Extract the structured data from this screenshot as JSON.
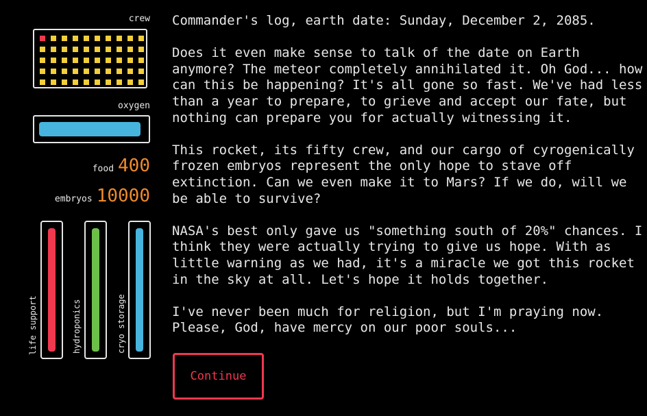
{
  "sidebar": {
    "crew": {
      "label": "crew",
      "total": 50,
      "active_index": 0,
      "dot_color": "#f2cf3a",
      "active_color": "#f0384f"
    },
    "oxygen": {
      "label": "oxygen",
      "level": 0.97,
      "color": "#47b4dd"
    },
    "food": {
      "label": "food",
      "value": "400"
    },
    "embryos": {
      "label": "embryos",
      "value": "10000"
    },
    "gauges": [
      {
        "label": "life support",
        "level": 1.0,
        "color": "#f0384f"
      },
      {
        "label": "hydroponics",
        "level": 1.0,
        "color": "#6cc04a"
      },
      {
        "label": "cryo storage",
        "level": 1.0,
        "color": "#47b4dd"
      }
    ],
    "value_color": "#f08a2c"
  },
  "log": {
    "paragraphs": [
      "Commander's log, earth date: Sunday, December 2, 2085.",
      "Does it even make sense to talk of the date on Earth anymore? The meteor completely annihilated it. Oh God... how can this be happening? It's all gone so fast. We've had less than a year to prepare, to grieve and accept our fate, but nothing can prepare you for actually witnessing it.",
      "This rocket, its fifty crew, and our cargo of cyrogenically frozen embryos represent the only hope to stave off extinction. Can we even make it to Mars? If we do, will we be able to survive?",
      "NASA's best only gave us \"something south of 20%\" chances. I think they were actually trying to give us hope. With as little warning as we had, it's a miracle we got this rocket in the sky at all. Let's hope it holds together.",
      "I've never been much for religion, but I'm praying now. Please, God, have mercy on our poor souls..."
    ]
  },
  "continue_button": {
    "label": "Continue",
    "color": "#f0384f"
  }
}
